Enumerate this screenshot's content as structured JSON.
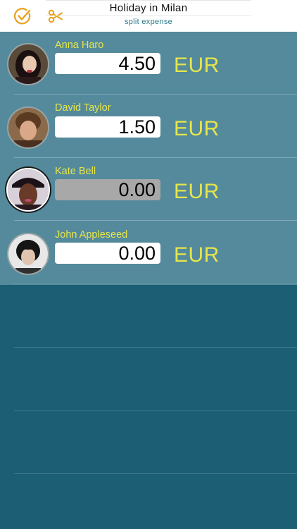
{
  "header": {
    "title": "Holiday in Milan",
    "subtitle": "split expense",
    "accent_color": "#e8a21c",
    "icons": [
      "check-circle-icon",
      "scissors-icon"
    ]
  },
  "participants": [
    {
      "name": "Anna Haro",
      "amount": "4.50",
      "currency": "EUR",
      "selected": false,
      "editable": true
    },
    {
      "name": "David Taylor",
      "amount": "1.50",
      "currency": "EUR",
      "selected": false,
      "editable": true
    },
    {
      "name": "Kate Bell",
      "amount": "0.00",
      "currency": "EUR",
      "selected": true,
      "editable": false
    },
    {
      "name": "John Appleseed",
      "amount": "0.00",
      "currency": "EUR",
      "selected": false,
      "editable": true
    }
  ],
  "colors": {
    "name_text": "#e6e64a",
    "rows_background": "#548a9c",
    "page_background": "#1c5e74"
  }
}
